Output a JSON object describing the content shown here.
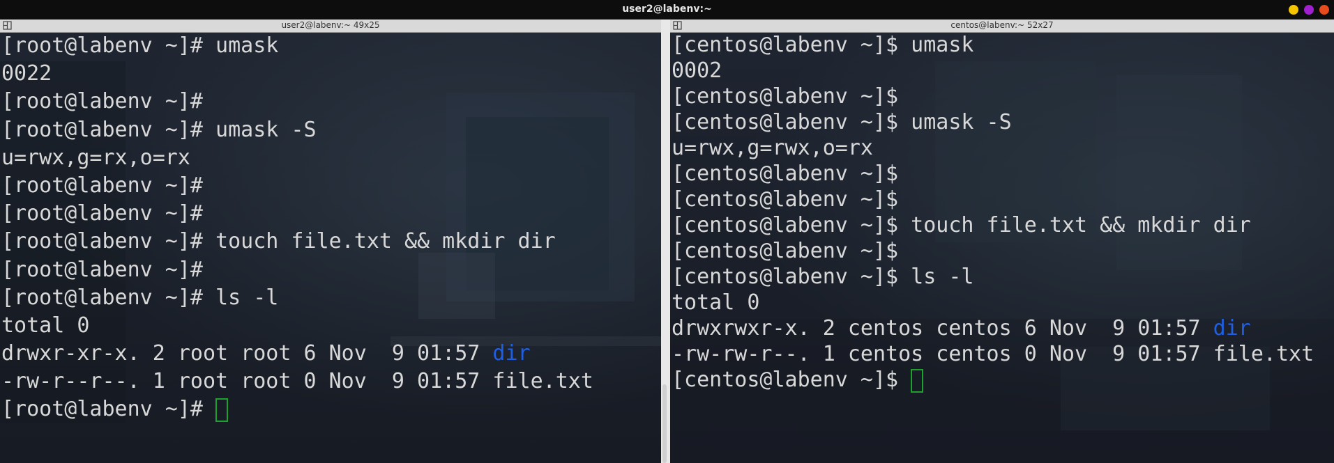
{
  "window": {
    "title": "user2@labenv:~",
    "buttons": [
      {
        "name": "minimize",
        "color": "#f5c400"
      },
      {
        "name": "maximize",
        "color": "#a020d0"
      },
      {
        "name": "close",
        "color": "#e84b1c"
      }
    ]
  },
  "left_pane": {
    "tab_title": "user2@labenv:~ 49x25",
    "lines": [
      {
        "text": "[root@labenv ~]# umask"
      },
      {
        "text": "0022"
      },
      {
        "text": "[root@labenv ~]#"
      },
      {
        "text": "[root@labenv ~]# umask -S"
      },
      {
        "text": "u=rwx,g=rx,o=rx"
      },
      {
        "text": "[root@labenv ~]#"
      },
      {
        "text": "[root@labenv ~]#"
      },
      {
        "text": "[root@labenv ~]# touch file.txt && mkdir dir"
      },
      {
        "text": "[root@labenv ~]#"
      },
      {
        "text": "[root@labenv ~]# ls -l"
      },
      {
        "text": "total 0"
      },
      {
        "text": "drwxr-xr-x. 2 root root 6 Nov  9 01:57 ",
        "highlight": "dir"
      },
      {
        "text": "-rw-r--r--. 1 root root 0 Nov  9 01:57 file.txt"
      },
      {
        "text": "[root@labenv ~]# ",
        "cursor": true
      }
    ]
  },
  "right_pane": {
    "tab_title": "centos@labenv:~ 52x27",
    "lines": [
      {
        "text": "[centos@labenv ~]$ umask"
      },
      {
        "text": "0002"
      },
      {
        "text": "[centos@labenv ~]$"
      },
      {
        "text": "[centos@labenv ~]$ umask -S"
      },
      {
        "text": "u=rwx,g=rwx,o=rx"
      },
      {
        "text": "[centos@labenv ~]$"
      },
      {
        "text": "[centos@labenv ~]$"
      },
      {
        "text": "[centos@labenv ~]$ touch file.txt && mkdir dir"
      },
      {
        "text": "[centos@labenv ~]$"
      },
      {
        "text": "[centos@labenv ~]$ ls -l"
      },
      {
        "text": "total 0"
      },
      {
        "text": "drwxrwxr-x. 2 centos centos 6 Nov  9 01:57 ",
        "highlight": "dir"
      },
      {
        "text": "-rw-rw-r--. 1 centos centos 0 Nov  9 01:57 file.txt"
      },
      {
        "text": "[centos@labenv ~]$ ",
        "cursor": true
      }
    ]
  },
  "colors": {
    "text": "#d8d8d8",
    "directory": "#1f5fe0",
    "cursor_outline": "#1fa12f"
  }
}
